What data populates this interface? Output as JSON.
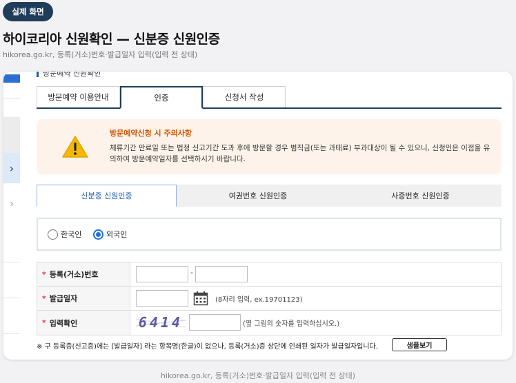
{
  "badge": "실제 화면",
  "page_title": "하이코리아 신원확인 — 신분증 신원인증",
  "page_subtitle": "hikorea.go.kr, 등록(거소)번호·발급일자 입력(입력 전 상태)",
  "cut_heading": "방문예약 신원확인",
  "tabs": [
    {
      "label": "방문예약 이용안내"
    },
    {
      "label": "인증"
    },
    {
      "label": "신청서 작성"
    }
  ],
  "notice": {
    "title": "방문예약신청 시 주의사항",
    "text": "체류기간 만료일 또는 법정 신고기간 도과 후에 방문할 경우 범칙금(또는 과태료) 부과대상이 될 수 있으니, 신청인은 이점을 유의하여 방문예약일자를 선택하시기 바랍니다.",
    "icon": "warning-icon"
  },
  "subtabs": [
    {
      "label": "신분증 신원인증"
    },
    {
      "label": "여권번호 신원인증"
    },
    {
      "label": "사증번호 신원인증"
    }
  ],
  "radios": [
    {
      "label": "한국인",
      "checked": false
    },
    {
      "label": "외국인",
      "checked": true
    }
  ],
  "form": {
    "reg_number_label": "등록(거소)번호",
    "reg_front_value": "",
    "reg_back_value": "",
    "dash": "-",
    "issue_date_label": "발급일자",
    "issue_date_value": "",
    "issue_date_hint": "(8자리 입력, ex.19701123)",
    "captcha_label": "입력확인",
    "captcha_text": "6414",
    "captcha_value": "",
    "captcha_hint": "(옆 그림의 숫자를 입력하십시오.)",
    "required_mark": "*"
  },
  "footnote": "※ 구 등록증(신고증)에는 [발급일자] 라는 항목명(한글)이 없으나, 등록(거소)증 상단에 인쇄된 일자가 발급일자입니다.",
  "sample_button": "샘플보기",
  "side_chevrons": [
    "›",
    "›"
  ],
  "caption": "hikorea.go.kr, 등록(거소)번호·발급일자 입력(입력 전 상태)",
  "colors": {
    "navy": "#1f3d5a",
    "accent_blue": "#1d6fe0",
    "warning_orange": "#d35400",
    "notice_bg": "#fdf3ea",
    "required_red": "#e03c3c"
  }
}
